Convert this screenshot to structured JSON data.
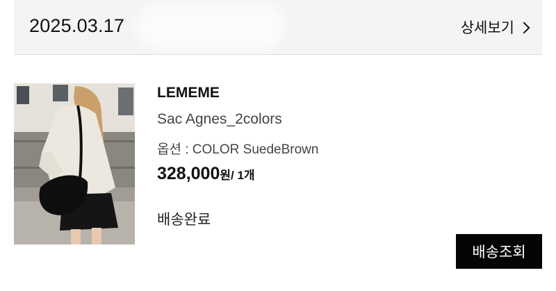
{
  "order": {
    "date": "2025.03.17",
    "detail_link_label": "상세보기"
  },
  "item": {
    "brand": "LEMEME",
    "product_name": "Sac Agnes_2colors",
    "option": "옵션 : COLOR SuedeBrown",
    "price": "328,000",
    "currency": "원",
    "quantity": "/ 1개",
    "status": "배송완료",
    "image": "product-photo"
  },
  "actions": {
    "track_label": "배송조회"
  },
  "icons": {
    "detail_arrow": "chevron-right-icon"
  },
  "colors": {
    "header_bg": "#f4f4f4",
    "button_bg": "#050505",
    "button_text": "#ffffff"
  }
}
